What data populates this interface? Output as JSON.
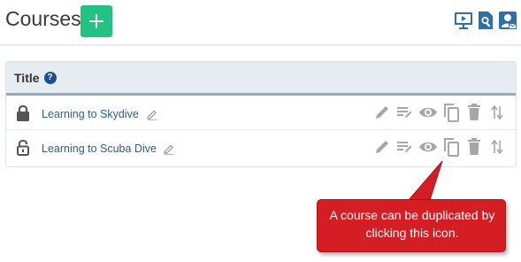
{
  "header": {
    "title": "Courses",
    "add_button_label": "+",
    "icons": [
      "presentation-icon",
      "search-document-icon",
      "user-email-icon"
    ]
  },
  "table": {
    "column_title": "Title",
    "help_label": "?",
    "rows": [
      {
        "title": "Learning to Skydive",
        "locked": true
      },
      {
        "title": "Learning to Scuba Dive",
        "locked": false
      }
    ],
    "row_actions": [
      "edit-icon",
      "edit-list-icon",
      "view-icon",
      "duplicate-icon",
      "delete-icon",
      "reorder-icon"
    ]
  },
  "callout": {
    "text": "A course can be duplicated by clicking this icon."
  },
  "colors": {
    "add_button": "#22c283",
    "header_bg": "#e6ecf2",
    "header_rule": "#8fa8cc",
    "link": "#2b5f8c",
    "action_icon": "#a7a7a7",
    "callout_bg": "#d51d24",
    "top_icon": "#2f6fa8"
  }
}
